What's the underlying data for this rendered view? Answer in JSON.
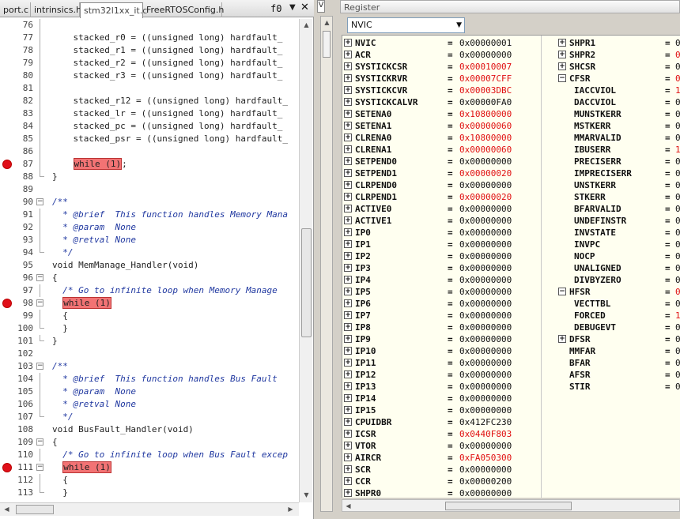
{
  "editor": {
    "tabs": [
      "port.c",
      "intrinsics.h",
      "stm32l1xx_it.c",
      "FreeRTOSConfig.h"
    ],
    "active_tab_index": 2,
    "function_dropdown": "f0",
    "lines": [
      {
        "n": "76",
        "t": "",
        "fold": "guide"
      },
      {
        "n": "77",
        "t": "    stacked_r0 = ((unsigned long) hardfault_",
        "fold": "guide"
      },
      {
        "n": "78",
        "t": "    stacked_r1 = ((unsigned long) hardfault_",
        "fold": "guide"
      },
      {
        "n": "79",
        "t": "    stacked_r2 = ((unsigned long) hardfault_",
        "fold": "guide"
      },
      {
        "n": "80",
        "t": "    stacked_r3 = ((unsigned long) hardfault_",
        "fold": "guide"
      },
      {
        "n": "81",
        "t": "",
        "fold": "guide"
      },
      {
        "n": "82",
        "t": "    stacked_r12 = ((unsigned long) hardfault_",
        "fold": "guide"
      },
      {
        "n": "83",
        "t": "    stacked_lr = ((unsigned long) hardfault_",
        "fold": "guide"
      },
      {
        "n": "84",
        "t": "    stacked_pc = ((unsigned long) hardfault_",
        "fold": "guide"
      },
      {
        "n": "85",
        "t": "    stacked_psr = ((unsigned long) hardfault_",
        "fold": "guide"
      },
      {
        "n": "86",
        "t": "",
        "fold": "guide"
      },
      {
        "n": "87",
        "t": "    while (1);",
        "fold": "guide",
        "bp": true,
        "hl": "while (1)",
        "pre": "    ",
        "post": ";"
      },
      {
        "n": "88",
        "t": "}",
        "fold": "end"
      },
      {
        "n": "89",
        "t": "",
        "fold": ""
      },
      {
        "n": "90",
        "t": "/**",
        "fold": "box",
        "cm": true
      },
      {
        "n": "91",
        "t": "  * @brief  This function handles Memory Mana",
        "fold": "guide",
        "cm": true
      },
      {
        "n": "92",
        "t": "  * @param  None",
        "fold": "guide",
        "cm": true
      },
      {
        "n": "93",
        "t": "  * @retval None",
        "fold": "guide",
        "cm": true
      },
      {
        "n": "94",
        "t": "  */",
        "fold": "end",
        "cm": true
      },
      {
        "n": "95",
        "t": "void MemManage_Handler(void)",
        "fold": ""
      },
      {
        "n": "96",
        "t": "{",
        "fold": "box"
      },
      {
        "n": "97",
        "t": "  /* Go to infinite loop when Memory Manage ",
        "fold": "guide",
        "cm": true
      },
      {
        "n": "98",
        "t": "  while (1)",
        "fold": "box",
        "bp": true,
        "hl": "while (1)",
        "pre": "  ",
        "post": ""
      },
      {
        "n": "99",
        "t": "  {",
        "fold": "guide"
      },
      {
        "n": "100",
        "t": "  }",
        "fold": "end"
      },
      {
        "n": "101",
        "t": "}",
        "fold": "end"
      },
      {
        "n": "102",
        "t": "",
        "fold": ""
      },
      {
        "n": "103",
        "t": "/**",
        "fold": "box",
        "cm": true
      },
      {
        "n": "104",
        "t": "  * @brief  This function handles Bus Fault ",
        "fold": "guide",
        "cm": true
      },
      {
        "n": "105",
        "t": "  * @param  None",
        "fold": "guide",
        "cm": true
      },
      {
        "n": "106",
        "t": "  * @retval None",
        "fold": "guide",
        "cm": true
      },
      {
        "n": "107",
        "t": "  */",
        "fold": "end",
        "cm": true
      },
      {
        "n": "108",
        "t": "void BusFault_Handler(void)",
        "fold": ""
      },
      {
        "n": "109",
        "t": "{",
        "fold": "box"
      },
      {
        "n": "110",
        "t": "  /* Go to infinite loop when Bus Fault excep",
        "fold": "guide",
        "cm": true
      },
      {
        "n": "111",
        "t": "  while (1)",
        "fold": "box",
        "bp": true,
        "hl": "while (1)",
        "pre": "  ",
        "post": ""
      },
      {
        "n": "112",
        "t": "  {",
        "fold": "guide"
      },
      {
        "n": "113",
        "t": "  }",
        "fold": "end"
      }
    ]
  },
  "register_panel": {
    "strip_tab": "V",
    "title": "Register",
    "group_select": "NVIC",
    "left_column": [
      {
        "name": "NVIC",
        "value": "0x00000001",
        "exp": "+"
      },
      {
        "name": "ACR",
        "value": "0x00000000",
        "exp": "+"
      },
      {
        "name": "SYSTICKCSR",
        "value": "0x00010007",
        "exp": "+",
        "changed": true
      },
      {
        "name": "SYSTICKRVR",
        "value": "0x00007CFF",
        "exp": "+",
        "changed": true
      },
      {
        "name": "SYSTICKCVR",
        "value": "0x00003DBC",
        "exp": "+",
        "changed": true
      },
      {
        "name": "SYSTICKCALVR",
        "value": "0x00000FA0",
        "exp": "+"
      },
      {
        "name": "SETENA0",
        "value": "0x10800000",
        "exp": "+",
        "changed": true
      },
      {
        "name": "SETENA1",
        "value": "0x00000060",
        "exp": "+",
        "changed": true
      },
      {
        "name": "CLRENA0",
        "value": "0x10800000",
        "exp": "+",
        "changed": true
      },
      {
        "name": "CLRENA1",
        "value": "0x00000060",
        "exp": "+",
        "changed": true
      },
      {
        "name": "SETPEND0",
        "value": "0x00000000",
        "exp": "+"
      },
      {
        "name": "SETPEND1",
        "value": "0x00000020",
        "exp": "+",
        "changed": true
      },
      {
        "name": "CLRPEND0",
        "value": "0x00000000",
        "exp": "+"
      },
      {
        "name": "CLRPEND1",
        "value": "0x00000020",
        "exp": "+",
        "changed": true
      },
      {
        "name": "ACTIVE0",
        "value": "0x00000000",
        "exp": "+"
      },
      {
        "name": "ACTIVE1",
        "value": "0x00000000",
        "exp": "+"
      },
      {
        "name": "IP0",
        "value": "0x00000000",
        "exp": "+"
      },
      {
        "name": "IP1",
        "value": "0x00000000",
        "exp": "+"
      },
      {
        "name": "IP2",
        "value": "0x00000000",
        "exp": "+"
      },
      {
        "name": "IP3",
        "value": "0x00000000",
        "exp": "+"
      },
      {
        "name": "IP4",
        "value": "0x00000000",
        "exp": "+"
      },
      {
        "name": "IP5",
        "value": "0x00000000",
        "exp": "+"
      },
      {
        "name": "IP6",
        "value": "0x00000000",
        "exp": "+"
      },
      {
        "name": "IP7",
        "value": "0x00000000",
        "exp": "+"
      },
      {
        "name": "IP8",
        "value": "0x00000000",
        "exp": "+"
      },
      {
        "name": "IP9",
        "value": "0x00000000",
        "exp": "+"
      },
      {
        "name": "IP10",
        "value": "0x00000000",
        "exp": "+"
      },
      {
        "name": "IP11",
        "value": "0x00000000",
        "exp": "+"
      },
      {
        "name": "IP12",
        "value": "0x00000000",
        "exp": "+"
      },
      {
        "name": "IP13",
        "value": "0x00000000",
        "exp": "+"
      },
      {
        "name": "IP14",
        "value": "0x00000000",
        "exp": "+"
      },
      {
        "name": "IP15",
        "value": "0x00000000",
        "exp": "+"
      },
      {
        "name": "CPUIDBR",
        "value": "0x412FC230",
        "exp": "+"
      },
      {
        "name": "ICSR",
        "value": "0x0440F803",
        "exp": "+",
        "changed": true
      },
      {
        "name": "VTOR",
        "value": "0x00000000",
        "exp": "+"
      },
      {
        "name": "AIRCR",
        "value": "0xFA050300",
        "exp": "+",
        "changed": true
      },
      {
        "name": "SCR",
        "value": "0x00000000",
        "exp": "+"
      },
      {
        "name": "CCR",
        "value": "0x00000200",
        "exp": "+"
      },
      {
        "name": "SHPR0",
        "value": "0x00000000",
        "exp": "+"
      }
    ],
    "right_column": [
      {
        "name": "SHPR1",
        "value": "0",
        "exp": "+",
        "indent": 0
      },
      {
        "name": "SHPR2",
        "value": "0",
        "exp": "+",
        "indent": 0,
        "changed": true
      },
      {
        "name": "SHCSR",
        "value": "0",
        "exp": "+",
        "indent": 0
      },
      {
        "name": "CFSR",
        "value": "0",
        "exp": "-",
        "indent": 0,
        "changed": true
      },
      {
        "name": "IACCVIOL",
        "value": "1",
        "exp": "",
        "indent": 1,
        "changed": true
      },
      {
        "name": "DACCVIOL",
        "value": "0",
        "exp": "",
        "indent": 1
      },
      {
        "name": "MUNSTKERR",
        "value": "0",
        "exp": "",
        "indent": 1
      },
      {
        "name": "MSTKERR",
        "value": "0",
        "exp": "",
        "indent": 1
      },
      {
        "name": "MMARVALID",
        "value": "0",
        "exp": "",
        "indent": 1
      },
      {
        "name": "IBUSERR",
        "value": "1",
        "exp": "",
        "indent": 1,
        "changed": true
      },
      {
        "name": "PRECISERR",
        "value": "0",
        "exp": "",
        "indent": 1
      },
      {
        "name": "IMPRECISERR",
        "value": "0",
        "exp": "",
        "indent": 1
      },
      {
        "name": "UNSTKERR",
        "value": "0",
        "exp": "",
        "indent": 1
      },
      {
        "name": "STKERR",
        "value": "0",
        "exp": "",
        "indent": 1
      },
      {
        "name": "BFARVALID",
        "value": "0",
        "exp": "",
        "indent": 1
      },
      {
        "name": "UNDEFINSTR",
        "value": "0",
        "exp": "",
        "indent": 1
      },
      {
        "name": "INVSTATE",
        "value": "0",
        "exp": "",
        "indent": 1
      },
      {
        "name": "INVPC",
        "value": "0",
        "exp": "",
        "indent": 1
      },
      {
        "name": "NOCP",
        "value": "0",
        "exp": "",
        "indent": 1
      },
      {
        "name": "UNALIGNED",
        "value": "0",
        "exp": "",
        "indent": 1
      },
      {
        "name": "DIVBYZERO",
        "value": "0",
        "exp": "",
        "indent": 1
      },
      {
        "name": "HFSR",
        "value": "0",
        "exp": "-",
        "indent": 0,
        "changed": true
      },
      {
        "name": "VECTTBL",
        "value": "0",
        "exp": "",
        "indent": 1
      },
      {
        "name": "FORCED",
        "value": "1",
        "exp": "",
        "indent": 1,
        "changed": true
      },
      {
        "name": "DEBUGEVT",
        "value": "0",
        "exp": "",
        "indent": 1
      },
      {
        "name": "DFSR",
        "value": "0",
        "exp": "+",
        "indent": 0
      },
      {
        "name": "MMFAR",
        "value": "0",
        "exp": "",
        "indent": 0
      },
      {
        "name": "BFAR",
        "value": "0",
        "exp": "",
        "indent": 0
      },
      {
        "name": "AFSR",
        "value": "0",
        "exp": "",
        "indent": 0
      },
      {
        "name": "STIR",
        "value": "0",
        "exp": "",
        "indent": 0
      }
    ]
  }
}
